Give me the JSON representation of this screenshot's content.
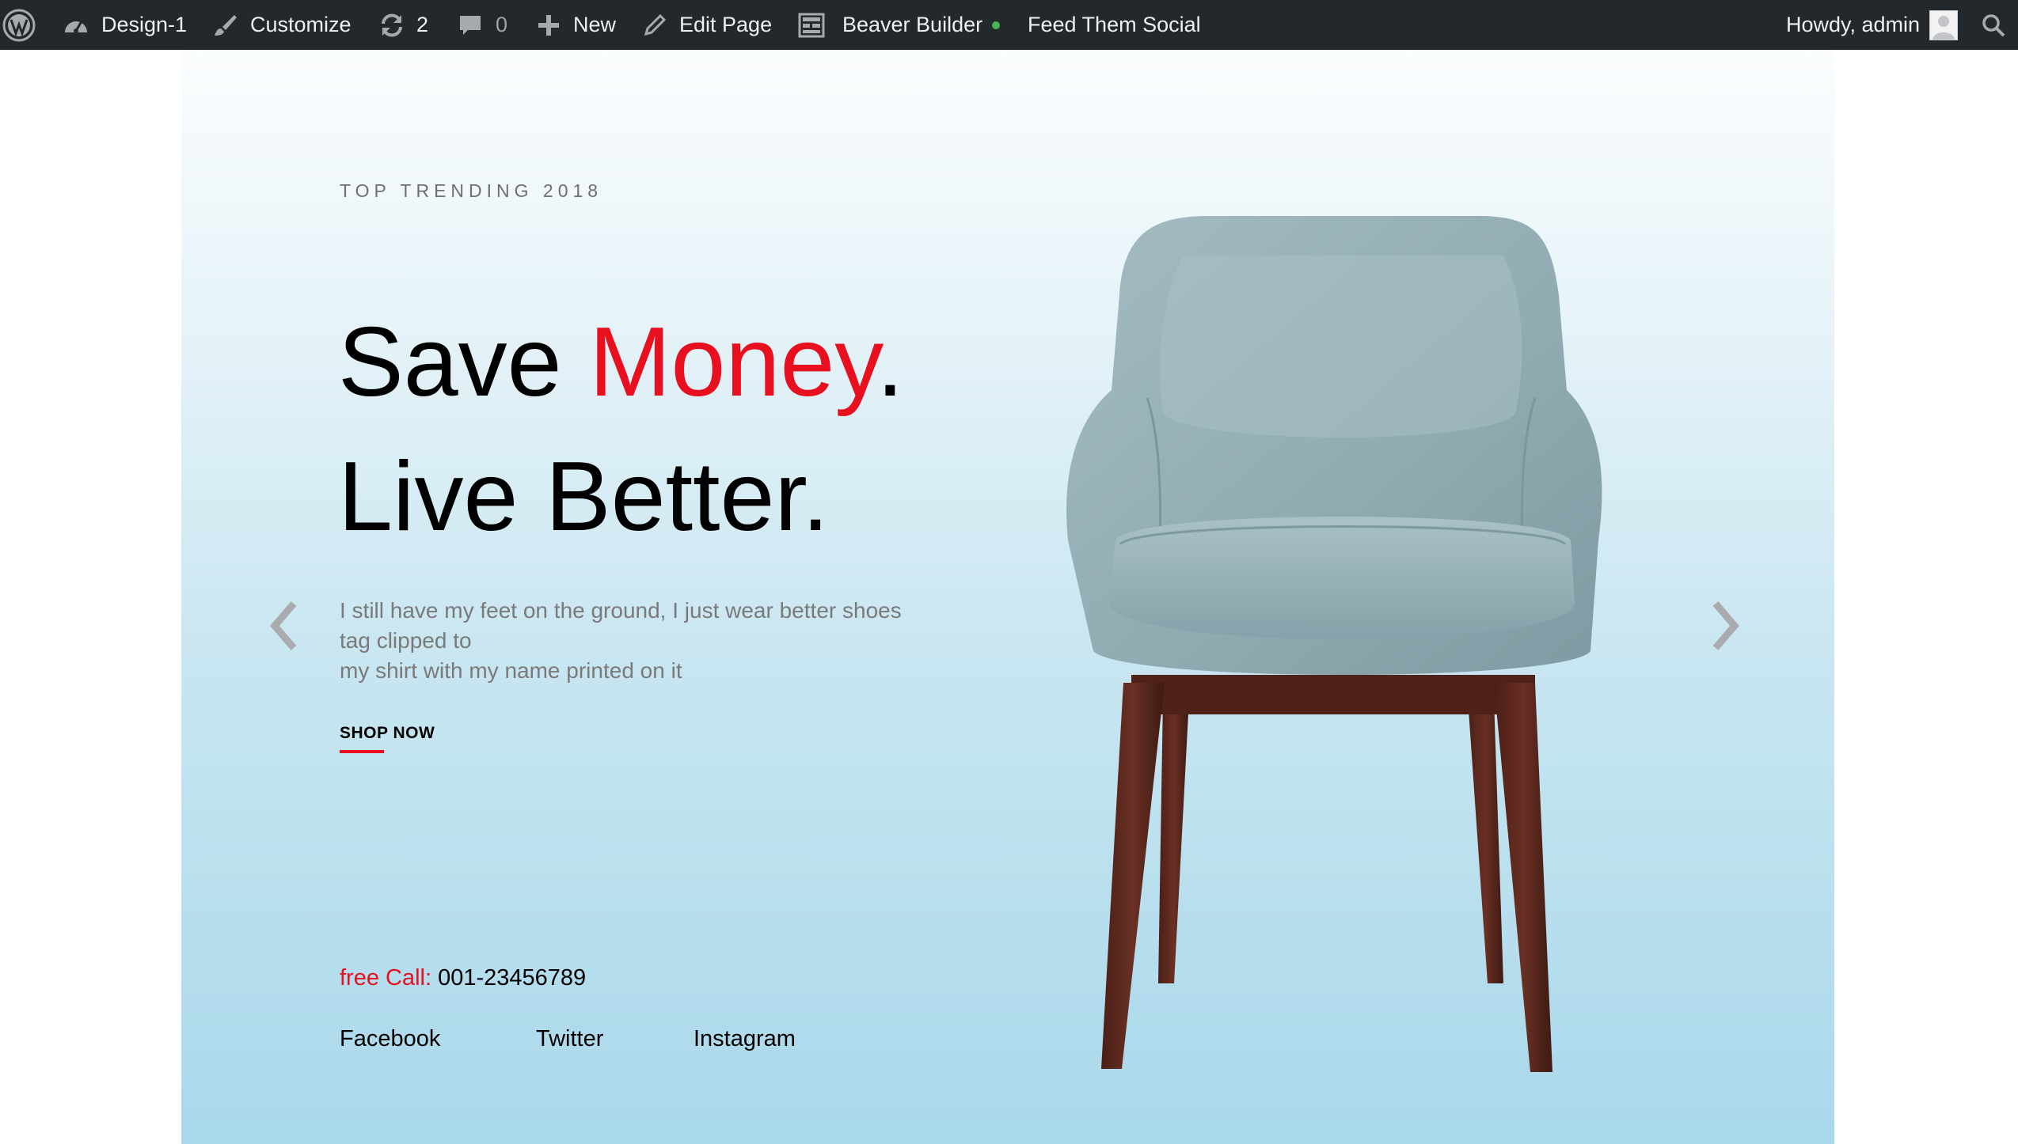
{
  "adminbar": {
    "site_name": "Design-1",
    "customize": "Customize",
    "updates_count": "2",
    "comments_count": "0",
    "new": "New",
    "edit_page": "Edit Page",
    "beaver_builder": "Beaver Builder",
    "feed_them_social": "Feed Them Social",
    "howdy": "Howdy, admin",
    "icons": [
      "wordpress-logo-icon",
      "dashboard-icon",
      "brush-icon",
      "updates-icon",
      "comment-icon",
      "plus-icon",
      "pencil-icon",
      "builder-icon",
      "search-icon"
    ],
    "status_dot_color": "#46b450",
    "bg_color": "#23282d"
  },
  "hero": {
    "eyebrow": "TOP TRENDING 2018",
    "headline_1_part1": "Save ",
    "headline_1_accent": "Money",
    "headline_1_end": ".",
    "headline_2": "Live Better.",
    "description_lines": [
      "I still have my feet on the ground, I just wear better shoes",
      "tag clipped to",
      "my shirt with my name printed on it"
    ],
    "cta": "SHOP NOW",
    "call_label": "free Call:",
    "call_number": "001-23456789",
    "social": [
      "Facebook",
      "Twitter",
      "Instagram"
    ],
    "accent_color": "#e8101e"
  }
}
